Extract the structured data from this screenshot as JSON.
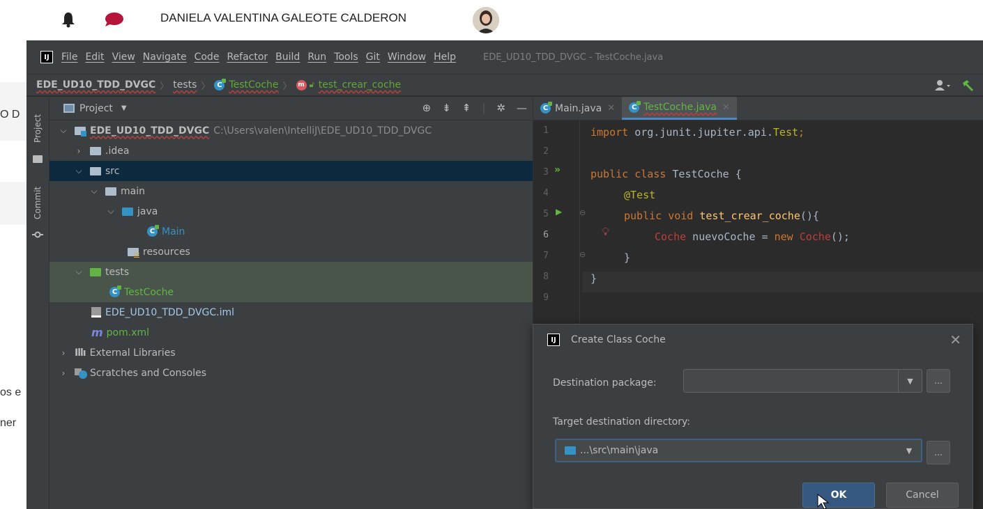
{
  "web": {
    "user_name": "DANIELA VALENTINA GALEOTE CALDERON",
    "side_fragments": [
      "O D",
      "os e",
      "ner"
    ]
  },
  "ide": {
    "menu": [
      "File",
      "Edit",
      "View",
      "Navigate",
      "Code",
      "Refactor",
      "Build",
      "Run",
      "Tools",
      "Git",
      "Window",
      "Help"
    ],
    "window_title": "EDE_UD10_TDD_DVGC - TestCoche.java",
    "logo_text": "IJ",
    "breadcrumb": {
      "project": "EDE_UD10_TDD_DVGC",
      "folder": "tests",
      "class": "TestCoche",
      "method": "test_crear_coche"
    },
    "side_tabs": {
      "project": "Project",
      "commit": "Commit"
    },
    "project_panel": {
      "title": "Project",
      "root_name": "EDE_UD10_TDD_DVGC",
      "root_path": "C:\\Users\\valen\\IntelliJ\\EDE_UD10_TDD_DVGC",
      "idea": ".idea",
      "src": "src",
      "main": "main",
      "java": "java",
      "main_class": "Main",
      "resources": "resources",
      "tests": "tests",
      "test_class": "TestCoche",
      "iml": "EDE_UD10_TDD_DVGC.iml",
      "pom": "pom.xml",
      "ext_libs": "External Libraries",
      "scratches": "Scratches and Consoles"
    },
    "tabs": [
      {
        "label": "Main.java",
        "active": false
      },
      {
        "label": "TestCoche.java",
        "active": true
      }
    ],
    "line_numbers": [
      "1",
      "2",
      "3",
      "4",
      "5",
      "6",
      "7",
      "8",
      "9"
    ],
    "code": {
      "l1_kw": "import",
      "l1_pkg": " org.junit.jupiter.api.",
      "l1_cls": "Test",
      "l1_end": ";",
      "l3_kw": "public class",
      "l3_name": " TestCoche {",
      "l4_ann": "@Test",
      "l5_kw": "public void",
      "l5_fn": " test_crear_coche",
      "l5_end": "(){",
      "l6_type": "Coche",
      "l6_var": " nuevoCoche = ",
      "l6_new": "new",
      "l6_ctor": " Coche",
      "l6_end": "();",
      "l7": "}",
      "l8": "}"
    }
  },
  "dialog": {
    "title": "Create Class Coche",
    "dest_package_label": "Destination package:",
    "dest_package_value": "",
    "target_dir_label": "Target destination directory:",
    "target_dir_value": "...\\src\\main\\java",
    "browse_label": "...",
    "ok": "OK",
    "cancel": "Cancel"
  },
  "colors": {
    "ide_bg": "#2b2b2b",
    "panel_bg": "#3c3f41",
    "selection": "#0d293e",
    "test_highlight": "#49544a",
    "accent": "#4a88c7",
    "error": "#bc3f3c"
  }
}
